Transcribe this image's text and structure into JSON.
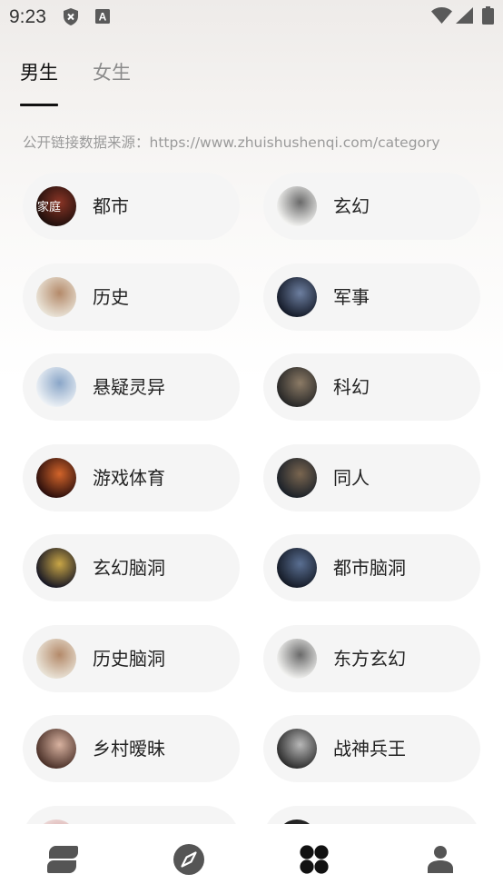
{
  "status_bar": {
    "time": "9:23",
    "notification_glyph": "A",
    "icon_color": "#5a5a5a"
  },
  "tabs": [
    {
      "label": "男生",
      "active": true
    },
    {
      "label": "女生",
      "active": false
    }
  ],
  "source_text": "公开链接数据来源：https://www.zhuishushenqi.com/category",
  "categories": [
    {
      "label": "都市",
      "cover_text": "家庭",
      "cover_colors": [
        "#1e0f0c",
        "#8b3526"
      ]
    },
    {
      "label": "玄幻",
      "cover_colors": [
        "#f4f4f2",
        "#6a6a6a"
      ]
    },
    {
      "label": "历史",
      "cover_colors": [
        "#eae4d8",
        "#b48a6a"
      ]
    },
    {
      "label": "军事",
      "cover_colors": [
        "#141a28",
        "#6d7fa0"
      ]
    },
    {
      "label": "悬疑灵异",
      "cover_colors": [
        "#eef2f6",
        "#8aa6c8"
      ]
    },
    {
      "label": "科幻",
      "cover_colors": [
        "#262626",
        "#8c7b66"
      ]
    },
    {
      "label": "游戏体育",
      "cover_colors": [
        "#2a0e0c",
        "#d2642a"
      ]
    },
    {
      "label": "同人",
      "cover_colors": [
        "#1a2028",
        "#7a6650"
      ]
    },
    {
      "label": "玄幻脑洞",
      "cover_colors": [
        "#161624",
        "#c9a646"
      ]
    },
    {
      "label": "都市脑洞",
      "cover_colors": [
        "#141a26",
        "#5a6f92"
      ]
    },
    {
      "label": "历史脑洞",
      "cover_colors": [
        "#eae4d8",
        "#b48a6a"
      ]
    },
    {
      "label": "东方玄幻",
      "cover_colors": [
        "#f4f4f2",
        "#6a6a6a"
      ]
    },
    {
      "label": "乡村暧昧",
      "cover_colors": [
        "#4a3028",
        "#d8b2a0"
      ]
    },
    {
      "label": "战神兵王",
      "cover_colors": [
        "#2c2c2c",
        "#b8b8b8"
      ]
    },
    {
      "cover_colors": [
        "#f1e6e4",
        "#d9a6a6"
      ]
    },
    {
      "cover_colors": [
        "#161616",
        "#3a3a3a"
      ]
    }
  ],
  "bottom_nav": [
    {
      "icon": "bookshelf-icon",
      "active": false
    },
    {
      "icon": "compass-icon",
      "active": false
    },
    {
      "icon": "category-grid-icon",
      "active": true
    },
    {
      "icon": "profile-icon",
      "active": false
    }
  ],
  "colors": {
    "accent": "#111111",
    "inactive_tab": "#8a8a8a",
    "card_bg": "#f5f5f5",
    "source_text": "#9a9a9a",
    "nav_inactive": "#555555",
    "nav_active": "#111111"
  }
}
